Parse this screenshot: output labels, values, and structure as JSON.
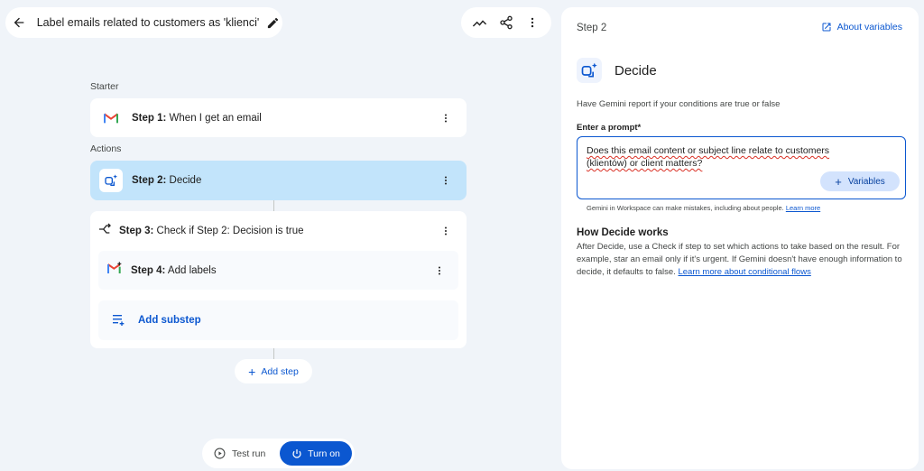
{
  "header": {
    "flow_title": "Label emails related to customers as 'klienci'"
  },
  "canvas": {
    "starter_label": "Starter",
    "actions_label": "Actions",
    "steps": [
      {
        "num": "Step 1:",
        "text": "When I get an email",
        "icon": "gmail-icon"
      },
      {
        "num": "Step 2:",
        "text": "Decide",
        "icon": "gemini-decide-icon"
      },
      {
        "num": "Step 3:",
        "text": "Check if Step 2: Decision is true",
        "icon": "branch-check-icon"
      },
      {
        "num": "Step 4:",
        "text": "Add labels",
        "icon": "gmail-add-icon"
      }
    ],
    "add_substep_label": "Add substep",
    "add_step_label": "Add step",
    "test_run_label": "Test run",
    "turn_on_label": "Turn on"
  },
  "panel": {
    "step_label": "Step 2",
    "about_variables_label": "About variables",
    "title": "Decide",
    "description": "Have Gemini report if your conditions are true or false",
    "prompt_label": "Enter a prompt*",
    "prompt_value": "Does this email content or subject line relate to customers (klientów) or client matters?",
    "variables_label": "Variables",
    "disclaimer_text": "Gemini in Workspace can make mistakes, including about people.",
    "disclaimer_link": "Learn more",
    "how_title": "How Decide works",
    "how_body": "After Decide, use a Check if step to set which actions to take based on the result. For example, star an email only if it's urgent. If Gemini doesn't have enough information to decide, it defaults to false.",
    "how_link": "Learn more about conditional flows"
  },
  "colors": {
    "accent": "#0b57d0",
    "selected_card": "#c2e4fb",
    "background": "#f0f4f9"
  }
}
